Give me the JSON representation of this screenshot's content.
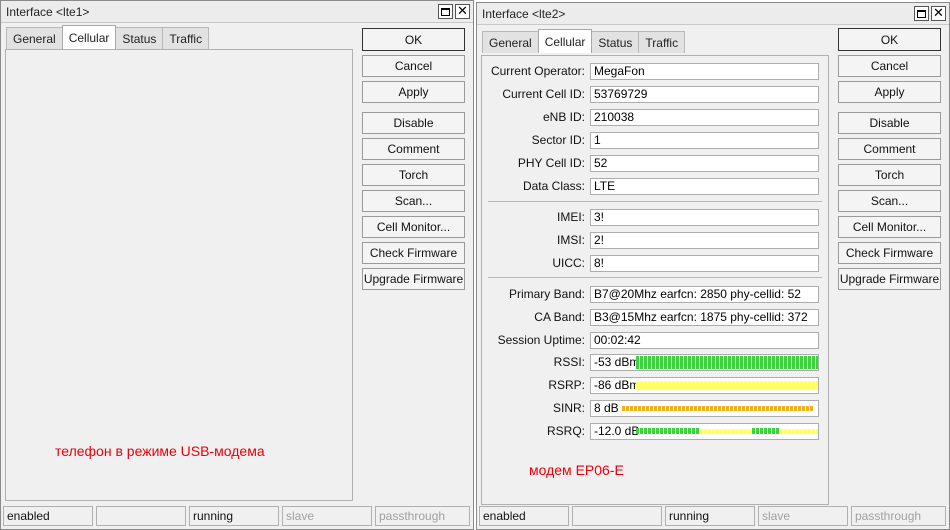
{
  "left_window": {
    "title": "Interface <lte1>",
    "tabs": [
      "General",
      "Cellular",
      "Status",
      "Traffic"
    ],
    "active_tab": "Cellular",
    "buttons": [
      "OK",
      "Cancel",
      "Apply",
      "Disable",
      "Comment",
      "Torch",
      "Scan...",
      "Cell Monitor...",
      "Check Firmware",
      "Upgrade Firmware"
    ],
    "status": [
      "enabled",
      "",
      "running",
      "slave",
      "passthrough"
    ],
    "annotation": "телефон в режиме USB-модема"
  },
  "right_window": {
    "title": "Interface <lte2>",
    "tabs": [
      "General",
      "Cellular",
      "Status",
      "Traffic"
    ],
    "active_tab": "Cellular",
    "buttons": [
      "OK",
      "Cancel",
      "Apply",
      "Disable",
      "Comment",
      "Torch",
      "Scan...",
      "Cell Monitor...",
      "Check Firmware",
      "Upgrade Firmware"
    ],
    "fields": {
      "current_operator": {
        "label": "Current Operator:",
        "value": "MegaFon"
      },
      "current_cell_id": {
        "label": "Current Cell ID:",
        "value": "53769729"
      },
      "enb_id": {
        "label": "eNB ID:",
        "value": "210038"
      },
      "sector_id": {
        "label": "Sector ID:",
        "value": "1"
      },
      "phy_cell_id": {
        "label": "PHY Cell ID:",
        "value": "52"
      },
      "data_class": {
        "label": "Data Class:",
        "value": "LTE"
      },
      "imei": {
        "label": "IMEI:",
        "value": "3!"
      },
      "imsi": {
        "label": "IMSI:",
        "value": "2!"
      },
      "uicc": {
        "label": "UICC:",
        "value": "8!"
      },
      "primary_band": {
        "label": "Primary Band:",
        "value": "B7@20Mhz earfcn: 2850 phy-cellid: 52"
      },
      "ca_band": {
        "label": "CA Band:",
        "value": "B3@15Mhz earfcn: 1875 phy-cellid: 372"
      },
      "session_uptime": {
        "label": "Session Uptime:",
        "value": "00:02:42"
      }
    },
    "signals": {
      "rssi": {
        "label": "RSSI:",
        "value": "-53 dBm",
        "level": 1.0,
        "color": "#3fd13f"
      },
      "rsrp": {
        "label": "RSRP:",
        "value": "-86 dBm",
        "level": 1.0,
        "color": "#ffff66"
      },
      "sinr": {
        "label": "SINR:",
        "value": "8 dB",
        "level": 1.0,
        "color": "#f0b020"
      },
      "rsrq": {
        "label": "RSRQ:",
        "value": "-12.0 dB",
        "level": 1.0,
        "color": "#3fd13f"
      }
    },
    "status": [
      "enabled",
      "",
      "running",
      "slave",
      "passthrough"
    ],
    "annotation": "модем EP06-E"
  }
}
